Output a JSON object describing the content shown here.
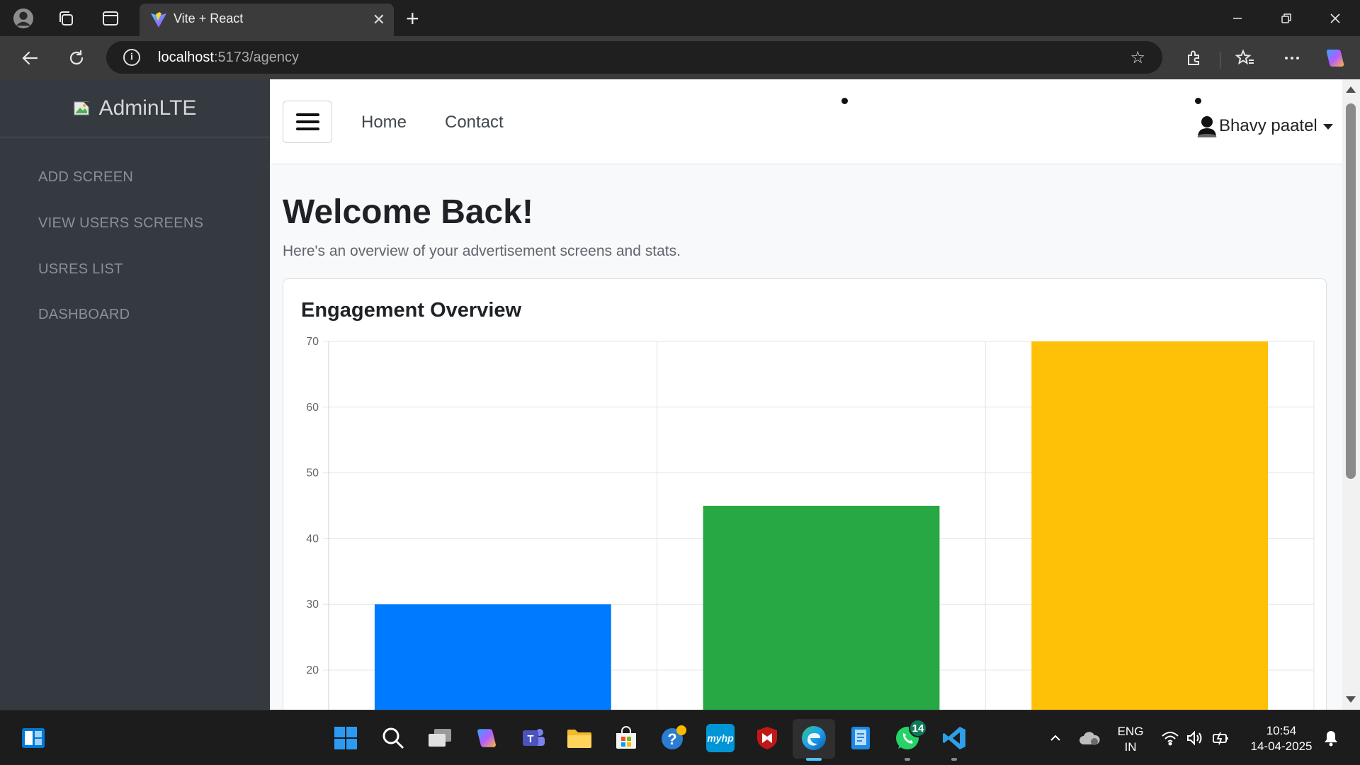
{
  "browser": {
    "tab_title": "Vite + React",
    "tab_close": "✕",
    "new_tab": "+",
    "url_host": "localhost",
    "url_path": ":5173/agency"
  },
  "sidebar": {
    "brand": "AdminLTE",
    "items": [
      {
        "label": "ADD SCREEN"
      },
      {
        "label": "VIEW USERS SCREENS"
      },
      {
        "label": "USRES LIST"
      },
      {
        "label": "DASHBOARD"
      }
    ]
  },
  "topnav": {
    "links": [
      "Home",
      "Contact"
    ],
    "user_name": "Bhavy paatel"
  },
  "main": {
    "welcome": "Welcome Back!",
    "subtitle": "Here's an overview of your advertisement screens and stats.",
    "card_title": "Engagement Overview"
  },
  "chart_data": {
    "type": "bar",
    "title": "Engagement Overview",
    "xlabel": "",
    "ylabel": "",
    "values": [
      30,
      45,
      70
    ],
    "colors": [
      "#007bff",
      "#28a745",
      "#ffc107"
    ],
    "y_ticks": [
      20,
      30,
      40,
      50,
      60,
      70
    ],
    "ylim_visible": [
      15,
      70
    ],
    "grid": true,
    "legend": "none"
  },
  "taskbar": {
    "lang_top": "ENG",
    "lang_bottom": "IN",
    "time": "10:54",
    "date": "14-04-2025",
    "whatsapp_badge": "14"
  },
  "colors": {
    "sidebar_bg": "#343a40",
    "page_bg": "#f8f9fa",
    "accent_blue": "#007bff",
    "accent_green": "#28a745",
    "accent_yellow": "#ffc107"
  }
}
